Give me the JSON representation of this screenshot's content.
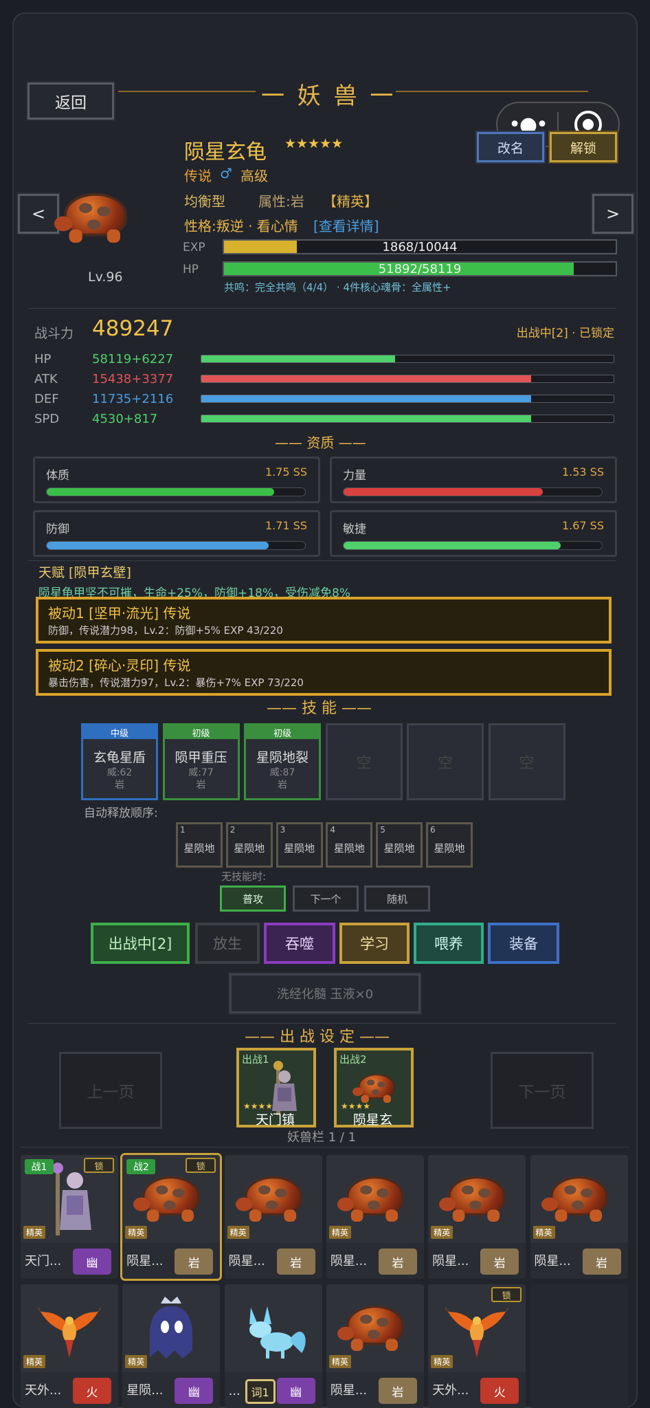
{
  "header": {
    "back": "返回",
    "title": "一 妖 兽 一",
    "rename": "改名",
    "unlock": "解锁",
    "more_icon": "dots-icon",
    "target_icon": "target-icon"
  },
  "pet": {
    "name": "陨星玄龟",
    "stars": "★★★★★",
    "rarity": "传说",
    "gender": "♂",
    "grade": "高级",
    "type": "均衡型",
    "attr": "属性:岩",
    "elite": "【精英】",
    "personality": "性格:叛逆 · 看心情",
    "detail_link": "[查看详情]",
    "level": "Lv.96",
    "exp_label": "EXP",
    "exp_text": "1868/10044",
    "exp_ratio": 0.186,
    "hp_label": "HP",
    "hp_text": "51892/58119",
    "hp_ratio": 0.893,
    "resonance": "共鸣：完全共鸣（4/4） · 4件核心魂骨：全属性+"
  },
  "power": {
    "label": "战斗力",
    "value": "489247",
    "status": "出战中[2] · 已锁定"
  },
  "stats": [
    {
      "name": "HP",
      "value": "58119+6227",
      "color": "#4fd06a",
      "ratio": 0.47
    },
    {
      "name": "ATK",
      "value": "15438+3377",
      "color": "#e25555",
      "ratio": 0.8
    },
    {
      "name": "DEF",
      "value": "11735+2116",
      "color": "#4a9ee0",
      "ratio": 0.8
    },
    {
      "name": "SPD",
      "value": "4530+817",
      "color": "#4fd06a",
      "ratio": 0.8
    }
  ],
  "aptitude": {
    "title": "—— 资质 ——",
    "items": [
      {
        "name": "体质",
        "value": "1.75 SS",
        "color": "#3bbf4a",
        "ratio": 0.88
      },
      {
        "name": "力量",
        "value": "1.53 SS",
        "color": "#d9413f",
        "ratio": 0.77
      },
      {
        "name": "防御",
        "value": "1.71 SS",
        "color": "#4a9ee0",
        "ratio": 0.86
      },
      {
        "name": "敏捷",
        "value": "1.67 SS",
        "color": "#4fd06a",
        "ratio": 0.84
      }
    ]
  },
  "talent": {
    "title": "天赋 [陨甲玄壁]",
    "desc": "陨星龟甲坚不可摧，生命+25%，防御+18%，受伤减免8%"
  },
  "passives": [
    {
      "title": "被动1 [坚甲·流光]  传说",
      "desc": "防御，传说潜力98，Lv.2：防御+5%  EXP 43/220"
    },
    {
      "title": "被动2 [碎心·灵印]  传说",
      "desc": "暴击伤害，传说潜力97，Lv.2：暴伤+7%  EXP 73/220"
    }
  ],
  "skills": {
    "title": "—— 技 能 ——",
    "slots": [
      {
        "level": "中级",
        "name": "玄龟星盾",
        "power": "威:62",
        "elem": "岩",
        "color": "#2f6fc0"
      },
      {
        "level": "初级",
        "name": "陨甲重压",
        "power": "威:77",
        "elem": "岩",
        "color": "#3a8f3e"
      },
      {
        "level": "初级",
        "name": "星陨地裂",
        "power": "威:87",
        "elem": "岩",
        "color": "#3a8f3e"
      },
      {
        "empty": "空"
      },
      {
        "empty": "空"
      },
      {
        "empty": "空"
      }
    ],
    "order_label": "自动释放顺序:",
    "order": [
      {
        "n": "1",
        "t": "星陨地"
      },
      {
        "n": "2",
        "t": "星陨地"
      },
      {
        "n": "3",
        "t": "星陨地"
      },
      {
        "n": "4",
        "t": "星陨地"
      },
      {
        "n": "5",
        "t": "星陨地"
      },
      {
        "n": "6",
        "t": "星陨地"
      }
    ],
    "noskill_label": "无技能时:",
    "noskill_options": [
      "普攻",
      "下一个",
      "随机"
    ]
  },
  "actions": {
    "battle": "出战中[2]",
    "release": "放生",
    "devour": "吞噬",
    "learn": "学习",
    "feed": "喂养",
    "equip": "装备",
    "wash": "洗经化髓  玉液×0"
  },
  "deploy": {
    "title": "—— 出 战 设 定 ——",
    "prev": "上一页",
    "next": "下一页",
    "slot1_label": "出战1",
    "slot1_name": "天门镇",
    "slot2_label": "出战2",
    "slot2_name": "陨星玄",
    "stars": "★★★★",
    "pen": "妖兽栏 1 / 1"
  },
  "roster": [
    {
      "name": "天门...",
      "elem": "幽",
      "elem_color": "#7b3fa8",
      "tag": "精英",
      "battle": "战1",
      "lock": "锁",
      "kind": "knight"
    },
    {
      "name": "陨星...",
      "elem": "岩",
      "elem_color": "#8a7450",
      "tag": "精英",
      "battle": "战2",
      "lock": "锁",
      "kind": "turtle"
    },
    {
      "name": "陨星...",
      "elem": "岩",
      "elem_color": "#8a7450",
      "tag": "精英",
      "kind": "turtle"
    },
    {
      "name": "陨星...",
      "elem": "岩",
      "elem_color": "#8a7450",
      "tag": "精英",
      "kind": "turtle"
    },
    {
      "name": "陨星...",
      "elem": "岩",
      "elem_color": "#8a7450",
      "tag": "精英",
      "kind": "turtle"
    },
    {
      "name": "陨星...",
      "elem": "岩",
      "elem_color": "#8a7450",
      "tag": "精英",
      "kind": "turtle"
    },
    {
      "name": "天外...",
      "elem": "火",
      "elem_color": "#c0392b",
      "tag": "精英",
      "kind": "phoenix"
    },
    {
      "name": "星陨...",
      "elem": "幽",
      "elem_color": "#7b3fa8",
      "tag": "精英",
      "kind": "ghost"
    },
    {
      "name": "...",
      "elem": "幽",
      "elem_color": "#7b3fa8",
      "tag": "",
      "word": "词1",
      "kind": "fox"
    },
    {
      "name": "陨星...",
      "elem": "岩",
      "elem_color": "#8a7450",
      "tag": "精英",
      "kind": "turtle"
    },
    {
      "name": "天外...",
      "elem": "火",
      "elem_color": "#c0392b",
      "tag": "精英",
      "lock": "锁",
      "kind": "phoenix"
    }
  ]
}
